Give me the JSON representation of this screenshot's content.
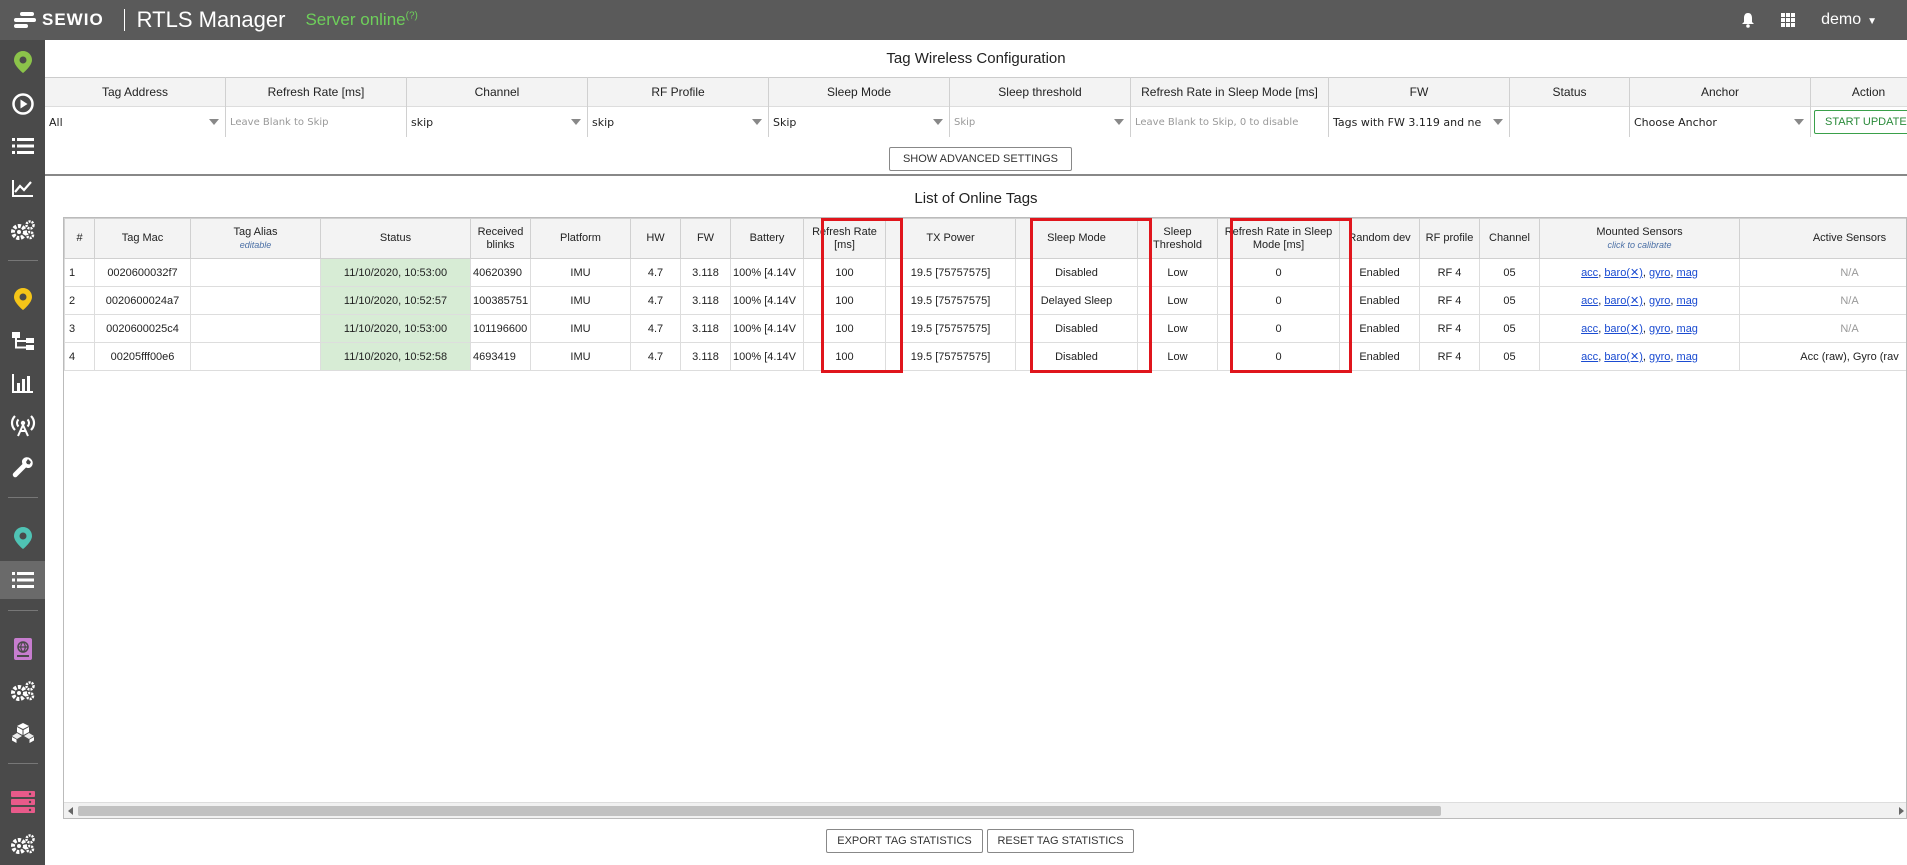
{
  "topbar": {
    "logo_text": "SEWIO",
    "app_title": "RTLS Manager",
    "server_status": "Server online",
    "server_status_sup": "(?)",
    "user": "demo"
  },
  "icons": {
    "bell": "bell-icon",
    "apps": "apps-grid-icon",
    "caret": "caret-down-icon"
  },
  "colors": {
    "topbar_bg": "#5a5a5a",
    "sidebar_bg": "#4a4a4a",
    "server_online": "#6ecf5a",
    "status_cell_bg": "#d7ecd5",
    "highlight": "#e0151c",
    "link": "#1a4bd1",
    "start_button": "#2a8a3a"
  },
  "config": {
    "title": "Tag Wireless Configuration",
    "columns": [
      {
        "label": "Tag Address",
        "value": "All",
        "placeholder": false,
        "dropdown": true
      },
      {
        "label": "Refresh Rate [ms]",
        "value": "Leave Blank to Skip",
        "placeholder": true,
        "dropdown": false
      },
      {
        "label": "Channel",
        "value": "skip",
        "placeholder": false,
        "dropdown": true
      },
      {
        "label": "RF Profile",
        "value": "skip",
        "placeholder": false,
        "dropdown": true
      },
      {
        "label": "Sleep Mode",
        "value": "Skip",
        "placeholder": false,
        "dropdown": true
      },
      {
        "label": "Sleep threshold",
        "value": "Skip",
        "placeholder": true,
        "dropdown": true
      },
      {
        "label": "Refresh Rate in Sleep Mode [ms]",
        "value": "Leave Blank to Skip, 0 to disable",
        "placeholder": true,
        "dropdown": false
      },
      {
        "label": "FW",
        "value": "Tags with FW 3.119 and ne",
        "placeholder": false,
        "dropdown": true
      },
      {
        "label": "Status",
        "value": "",
        "placeholder": false,
        "dropdown": false
      },
      {
        "label": "Anchor",
        "value": "Choose Anchor",
        "placeholder": false,
        "dropdown": true
      },
      {
        "label": "Action",
        "value": "",
        "placeholder": false,
        "dropdown": false
      }
    ],
    "start_button": "START UPDATE",
    "advanced_button": "SHOW ADVANCED SETTINGS"
  },
  "tags": {
    "title": "List of Online Tags",
    "headers": [
      {
        "label": "#"
      },
      {
        "label": "Tag Mac"
      },
      {
        "label": "Tag Alias",
        "sub": "editable"
      },
      {
        "label": "Status"
      },
      {
        "label": "Received blinks"
      },
      {
        "label": "Platform"
      },
      {
        "label": "HW"
      },
      {
        "label": "FW"
      },
      {
        "label": "Battery"
      },
      {
        "label": "Refresh Rate [ms]"
      },
      {
        "label": "TX Power"
      },
      {
        "label": "Sleep Mode"
      },
      {
        "label": "Sleep Threshold"
      },
      {
        "label": "Refresh Rate in Sleep Mode [ms]"
      },
      {
        "label": "Random dev"
      },
      {
        "label": "RF profile"
      },
      {
        "label": "Channel"
      },
      {
        "label": "Mounted Sensors",
        "sub": "click to calibrate"
      },
      {
        "label": "Active Sensors"
      }
    ],
    "rows": [
      {
        "num": "1",
        "mac": "0020600032f7",
        "alias": "",
        "status": "11/10/2020, 10:53:00",
        "blinks": "40620390",
        "platform": "IMU",
        "hw": "4.7",
        "fw": "3.118",
        "battery": "100% [4.14V",
        "refresh": "100",
        "tx": "19.5 [75757575]",
        "sleep_mode": "Disabled",
        "sleep_threshold": "Low",
        "sleep_refresh": "0",
        "random_dev": "Enabled",
        "rf_profile": "RF 4",
        "channel": "05",
        "sensors": [
          "acc",
          "baro(✕)",
          "gyro",
          "mag"
        ],
        "active": "N/A"
      },
      {
        "num": "2",
        "mac": "0020600024a7",
        "alias": "",
        "status": "11/10/2020, 10:52:57",
        "blinks": "100385751",
        "platform": "IMU",
        "hw": "4.7",
        "fw": "3.118",
        "battery": "100% [4.14V",
        "refresh": "100",
        "tx": "19.5 [75757575]",
        "sleep_mode": "Delayed Sleep",
        "sleep_threshold": "Low",
        "sleep_refresh": "0",
        "random_dev": "Enabled",
        "rf_profile": "RF 4",
        "channel": "05",
        "sensors": [
          "acc",
          "baro(✕)",
          "gyro",
          "mag"
        ],
        "active": "N/A"
      },
      {
        "num": "3",
        "mac": "0020600025c4",
        "alias": "",
        "status": "11/10/2020, 10:53:00",
        "blinks": "101196600",
        "platform": "IMU",
        "hw": "4.7",
        "fw": "3.118",
        "battery": "100% [4.14V",
        "refresh": "100",
        "tx": "19.5 [75757575]",
        "sleep_mode": "Disabled",
        "sleep_threshold": "Low",
        "sleep_refresh": "0",
        "random_dev": "Enabled",
        "rf_profile": "RF 4",
        "channel": "05",
        "sensors": [
          "acc",
          "baro(✕)",
          "gyro",
          "mag"
        ],
        "active": "N/A"
      },
      {
        "num": "4",
        "mac": "00205fff00e6",
        "alias": "",
        "status": "11/10/2020, 10:52:58",
        "blinks": "4693419",
        "platform": "IMU",
        "hw": "4.7",
        "fw": "3.118",
        "battery": "100% [4.14V",
        "refresh": "100",
        "tx": "19.5 [75757575]",
        "sleep_mode": "Disabled",
        "sleep_threshold": "Low",
        "sleep_refresh": "0",
        "random_dev": "Enabled",
        "rf_profile": "RF 4",
        "channel": "05",
        "sensors": [
          "acc",
          "baro(✕)",
          "gyro",
          "mag"
        ],
        "active": "Acc (raw), Gyro (rav"
      }
    ]
  },
  "footer": {
    "export_button": "EXPORT TAG STATISTICS",
    "reset_button": "RESET TAG STATISTICS"
  },
  "sidebar": {
    "items": [
      {
        "icon": "map-pin-icon",
        "color": "#8bc34a"
      },
      {
        "icon": "play-circle-icon",
        "color": "#ffffff"
      },
      {
        "icon": "list-icon",
        "color": "#ffffff"
      },
      {
        "icon": "line-chart-icon",
        "color": "#ffffff"
      },
      {
        "icon": "gears-icon",
        "color": "#ffffff"
      },
      {
        "icon": "map-pin-icon",
        "color": "#f5c518"
      },
      {
        "icon": "sitemap-icon",
        "color": "#ffffff"
      },
      {
        "icon": "bar-chart-icon",
        "color": "#ffffff"
      },
      {
        "icon": "antenna-icon",
        "color": "#ffffff"
      },
      {
        "icon": "wrench-icon",
        "color": "#ffffff"
      },
      {
        "icon": "map-pin-icon",
        "color": "#4fc3b4"
      },
      {
        "icon": "list-icon",
        "color": "#ffffff"
      },
      {
        "icon": "globe-book-icon",
        "color": "#c77dcf"
      },
      {
        "icon": "gears-icon",
        "color": "#ffffff"
      },
      {
        "icon": "cubes-icon",
        "color": "#ffffff"
      },
      {
        "icon": "server-icon",
        "color": "#e85a8a"
      },
      {
        "icon": "gears-icon",
        "color": "#ffffff"
      }
    ]
  }
}
